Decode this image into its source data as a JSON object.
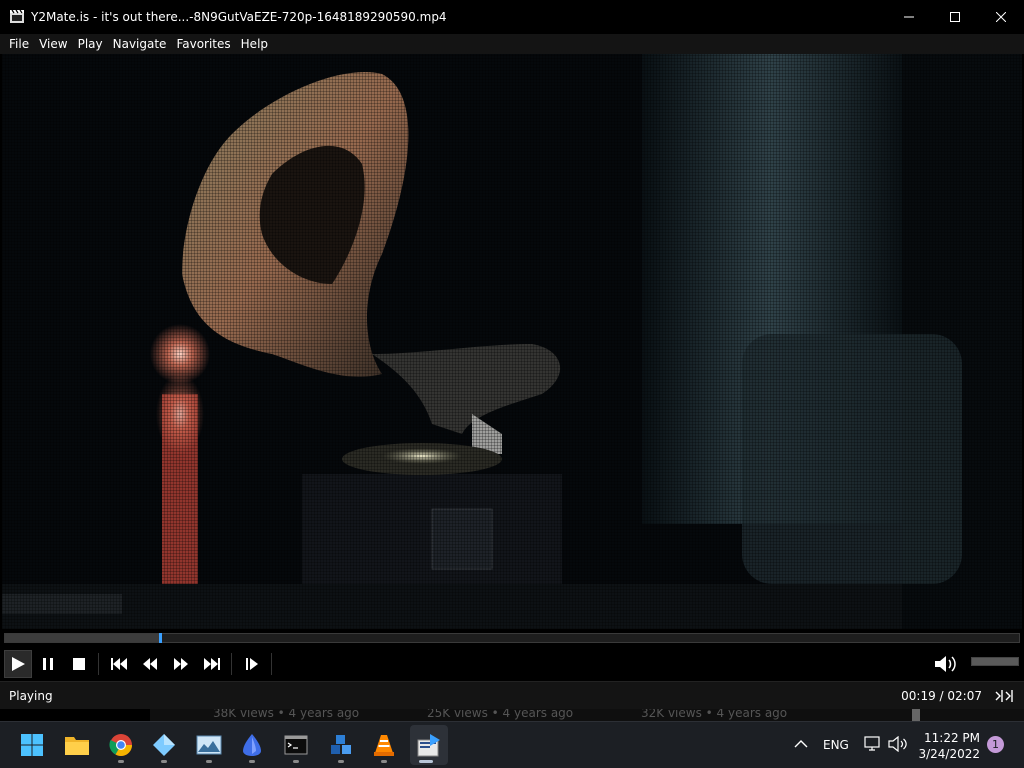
{
  "window": {
    "title": "Y2Mate.is - it's out there...-8N9GutVaEZE-720p-1648189290590.mp4",
    "controls": [
      "minimize-icon",
      "maximize-icon",
      "close-icon"
    ]
  },
  "menu": {
    "items": [
      {
        "label": "File"
      },
      {
        "label": "View"
      },
      {
        "label": "Play"
      },
      {
        "label": "Navigate"
      },
      {
        "label": "Favorites"
      },
      {
        "label": "Help"
      }
    ]
  },
  "player": {
    "progress_fraction": 0.153,
    "volume_fraction": 1.0,
    "buttons": [
      "play-icon",
      "pause-icon",
      "stop-icon",
      "previous-icon",
      "rewind-icon",
      "fast-forward-icon",
      "next-icon",
      "frame-step-icon"
    ],
    "accent_color": "#3aa0ff"
  },
  "status": {
    "state": "Playing",
    "time": "00:19 / 02:07"
  },
  "background_page": {
    "items": [
      {
        "text": "38K views • 4 years ago"
      },
      {
        "text": "25K views • 4 years ago"
      },
      {
        "text": "32K views • 4 years ago"
      }
    ]
  },
  "taskbar": {
    "apps": [
      "start-icon",
      "file-explorer-icon",
      "chrome-icon",
      "app-diamond-icon",
      "photos-icon",
      "app-blue-icon",
      "terminal-icon",
      "app-cubes-icon",
      "vlc-icon",
      "media-player-classic-icon"
    ],
    "language": "ENG",
    "clock_time": "11:22 PM",
    "clock_date": "3/24/2022",
    "notification_count": "1"
  }
}
